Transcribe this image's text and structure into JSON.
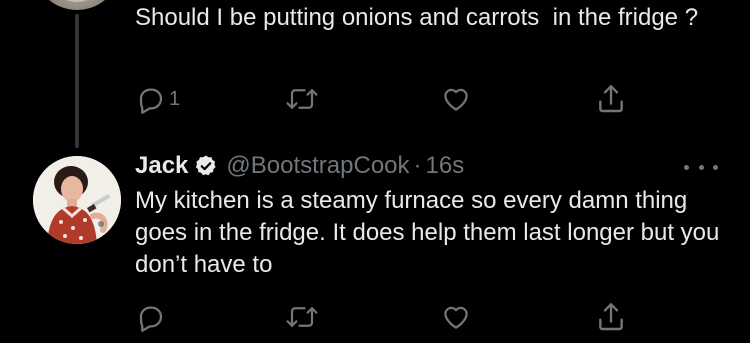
{
  "parent_tweet": {
    "text": "Should I be putting onions and carrots  in the fridge ?",
    "actions": {
      "reply_icon": "reply-icon",
      "reply_count": "1",
      "retweet_icon": "retweet-icon",
      "like_icon": "heart-icon",
      "share_icon": "share-icon"
    }
  },
  "reply_tweet": {
    "display_name": "Jack",
    "verified_icon": "verified-badge-icon",
    "handle": "@BootstrapCook",
    "separator": "·",
    "timestamp": "16s",
    "more_icon": "more-options-icon",
    "text": "My kitchen is a steamy furnace so every damn thing goes in the fridge. It does help them last longer but you don’t have to",
    "actions": {
      "reply_icon": "reply-icon",
      "retweet_icon": "retweet-icon",
      "like_icon": "heart-icon",
      "share_icon": "share-icon"
    }
  },
  "colors": {
    "background": "#000000",
    "text_primary": "#e7e9ea",
    "text_secondary": "#71767b",
    "thread_line": "#333639"
  }
}
